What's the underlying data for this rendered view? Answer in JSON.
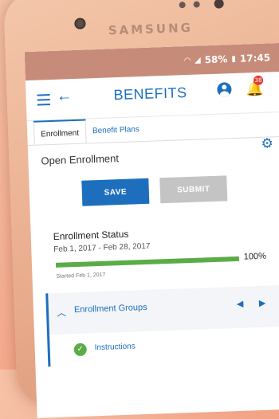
{
  "device": {
    "brand": "SAMSUNG"
  },
  "statusbar": {
    "battery": "58%",
    "time": "17:45"
  },
  "header": {
    "title": "BENEFITS",
    "notification_count": "38"
  },
  "tabs": [
    {
      "label": "Enrollment",
      "active": true
    },
    {
      "label": "Benefit Plans",
      "active": false
    }
  ],
  "main": {
    "section_title": "Open Enrollment",
    "save_label": "SAVE",
    "submit_label": "SUBMIT",
    "status": {
      "title": "Enrollment Status",
      "dates": "Feb 1, 2017 - Feb 28, 2017",
      "progress_value": 100,
      "progress_text": "100%",
      "started": "Started Feb 1, 2017"
    },
    "groups": {
      "label": "Enrollment Groups",
      "items": [
        {
          "label": "Instructions",
          "complete": true
        }
      ]
    }
  },
  "colors": {
    "accent": "#1d6fbd",
    "success": "#5aac47",
    "disabled": "#c4c4c4"
  }
}
